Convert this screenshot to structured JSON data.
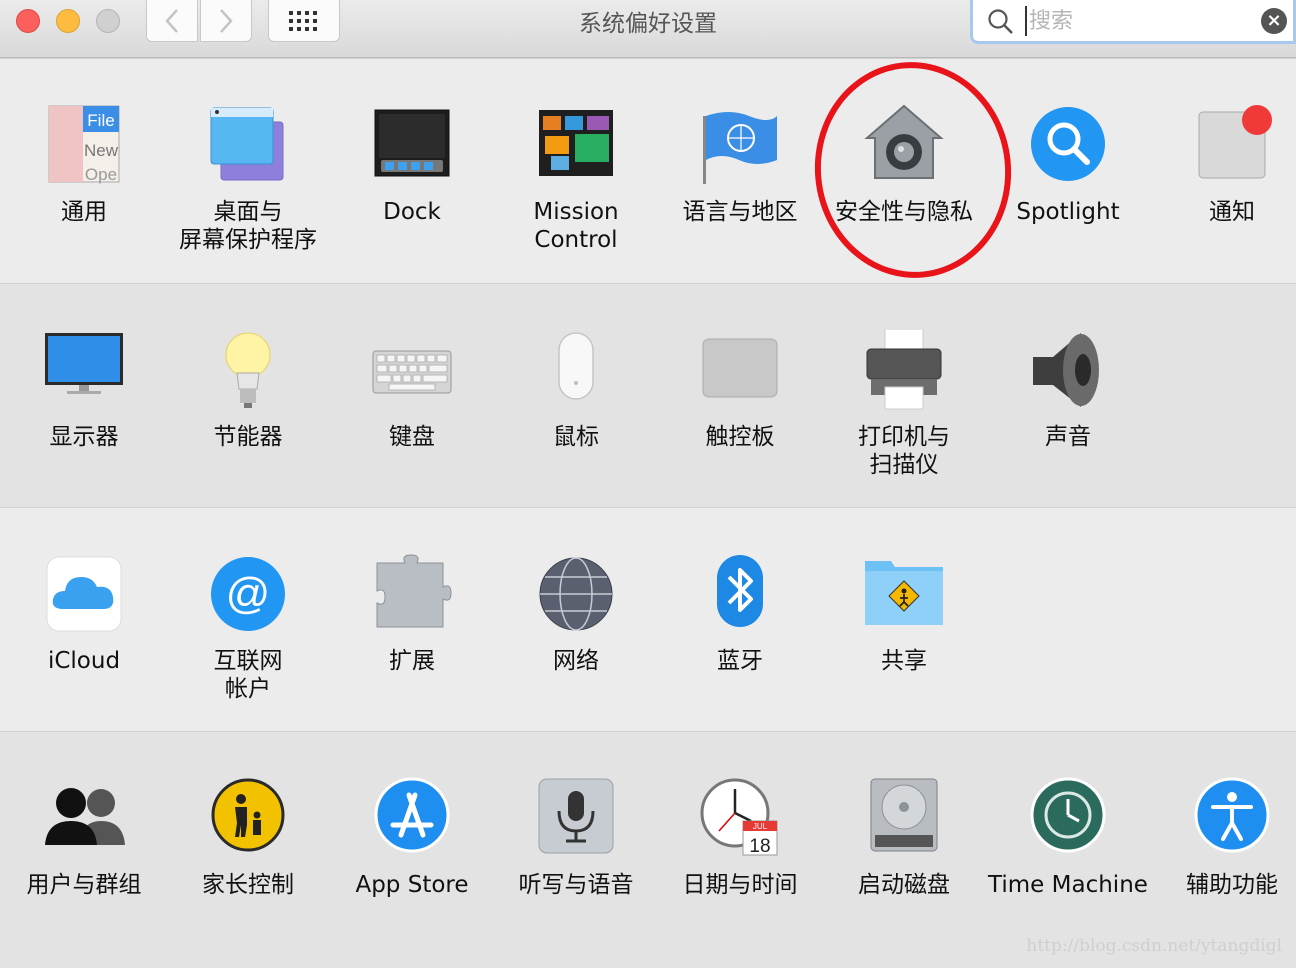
{
  "window": {
    "title": "系统偏好设置",
    "search_placeholder": "搜索",
    "nav": {
      "back_icon": "chevron-left-icon",
      "forward_icon": "chevron-right-icon",
      "grid_icon": "grid-icon"
    }
  },
  "rows": [
    [
      {
        "id": "general",
        "label": "通用",
        "icon": "general-icon"
      },
      {
        "id": "desktop",
        "label": "桌面与\n屏幕保护程序",
        "icon": "desktop-icon"
      },
      {
        "id": "dock",
        "label": "Dock",
        "icon": "dock-icon"
      },
      {
        "id": "mission",
        "label": "Mission\nControl",
        "icon": "mission-control-icon"
      },
      {
        "id": "language",
        "label": "语言与地区",
        "icon": "flag-icon"
      },
      {
        "id": "security",
        "label": "安全性与隐私",
        "icon": "house-lock-icon"
      },
      {
        "id": "spotlight",
        "label": "Spotlight",
        "icon": "magnifier-icon"
      },
      {
        "id": "notifications",
        "label": "通知",
        "icon": "notifications-icon"
      }
    ],
    [
      {
        "id": "displays",
        "label": "显示器",
        "icon": "monitor-icon"
      },
      {
        "id": "energy",
        "label": "节能器",
        "icon": "bulb-icon"
      },
      {
        "id": "keyboard",
        "label": "键盘",
        "icon": "keyboard-icon"
      },
      {
        "id": "mouse",
        "label": "鼠标",
        "icon": "mouse-icon"
      },
      {
        "id": "trackpad",
        "label": "触控板",
        "icon": "trackpad-icon"
      },
      {
        "id": "printers",
        "label": "打印机与\n扫描仪",
        "icon": "printer-icon"
      },
      {
        "id": "sound",
        "label": "声音",
        "icon": "speaker-icon"
      }
    ],
    [
      {
        "id": "icloud",
        "label": "iCloud",
        "icon": "cloud-icon"
      },
      {
        "id": "internet",
        "label": "互联网\n帐户",
        "icon": "at-icon"
      },
      {
        "id": "extensions",
        "label": "扩展",
        "icon": "puzzle-icon"
      },
      {
        "id": "network",
        "label": "网络",
        "icon": "globe-icon"
      },
      {
        "id": "bluetooth",
        "label": "蓝牙",
        "icon": "bluetooth-icon"
      },
      {
        "id": "sharing",
        "label": "共享",
        "icon": "folder-sharing-icon"
      }
    ],
    [
      {
        "id": "users",
        "label": "用户与群组",
        "icon": "users-icon"
      },
      {
        "id": "parental",
        "label": "家长控制",
        "icon": "parental-icon"
      },
      {
        "id": "appstore",
        "label": "App Store",
        "icon": "appstore-icon"
      },
      {
        "id": "dictation",
        "label": "听写与语音",
        "icon": "microphone-icon"
      },
      {
        "id": "datetime",
        "label": "日期与时间",
        "icon": "clock-icon"
      },
      {
        "id": "startup",
        "label": "启动磁盘",
        "icon": "disk-icon"
      },
      {
        "id": "timemachine",
        "label": "Time Machine",
        "icon": "time-machine-icon"
      },
      {
        "id": "accessibility",
        "label": "辅助功能",
        "icon": "accessibility-icon"
      }
    ]
  ],
  "calendar": {
    "month": "JUL",
    "day": "18"
  },
  "watermark": "http://blog.csdn.net/ytangdigl"
}
